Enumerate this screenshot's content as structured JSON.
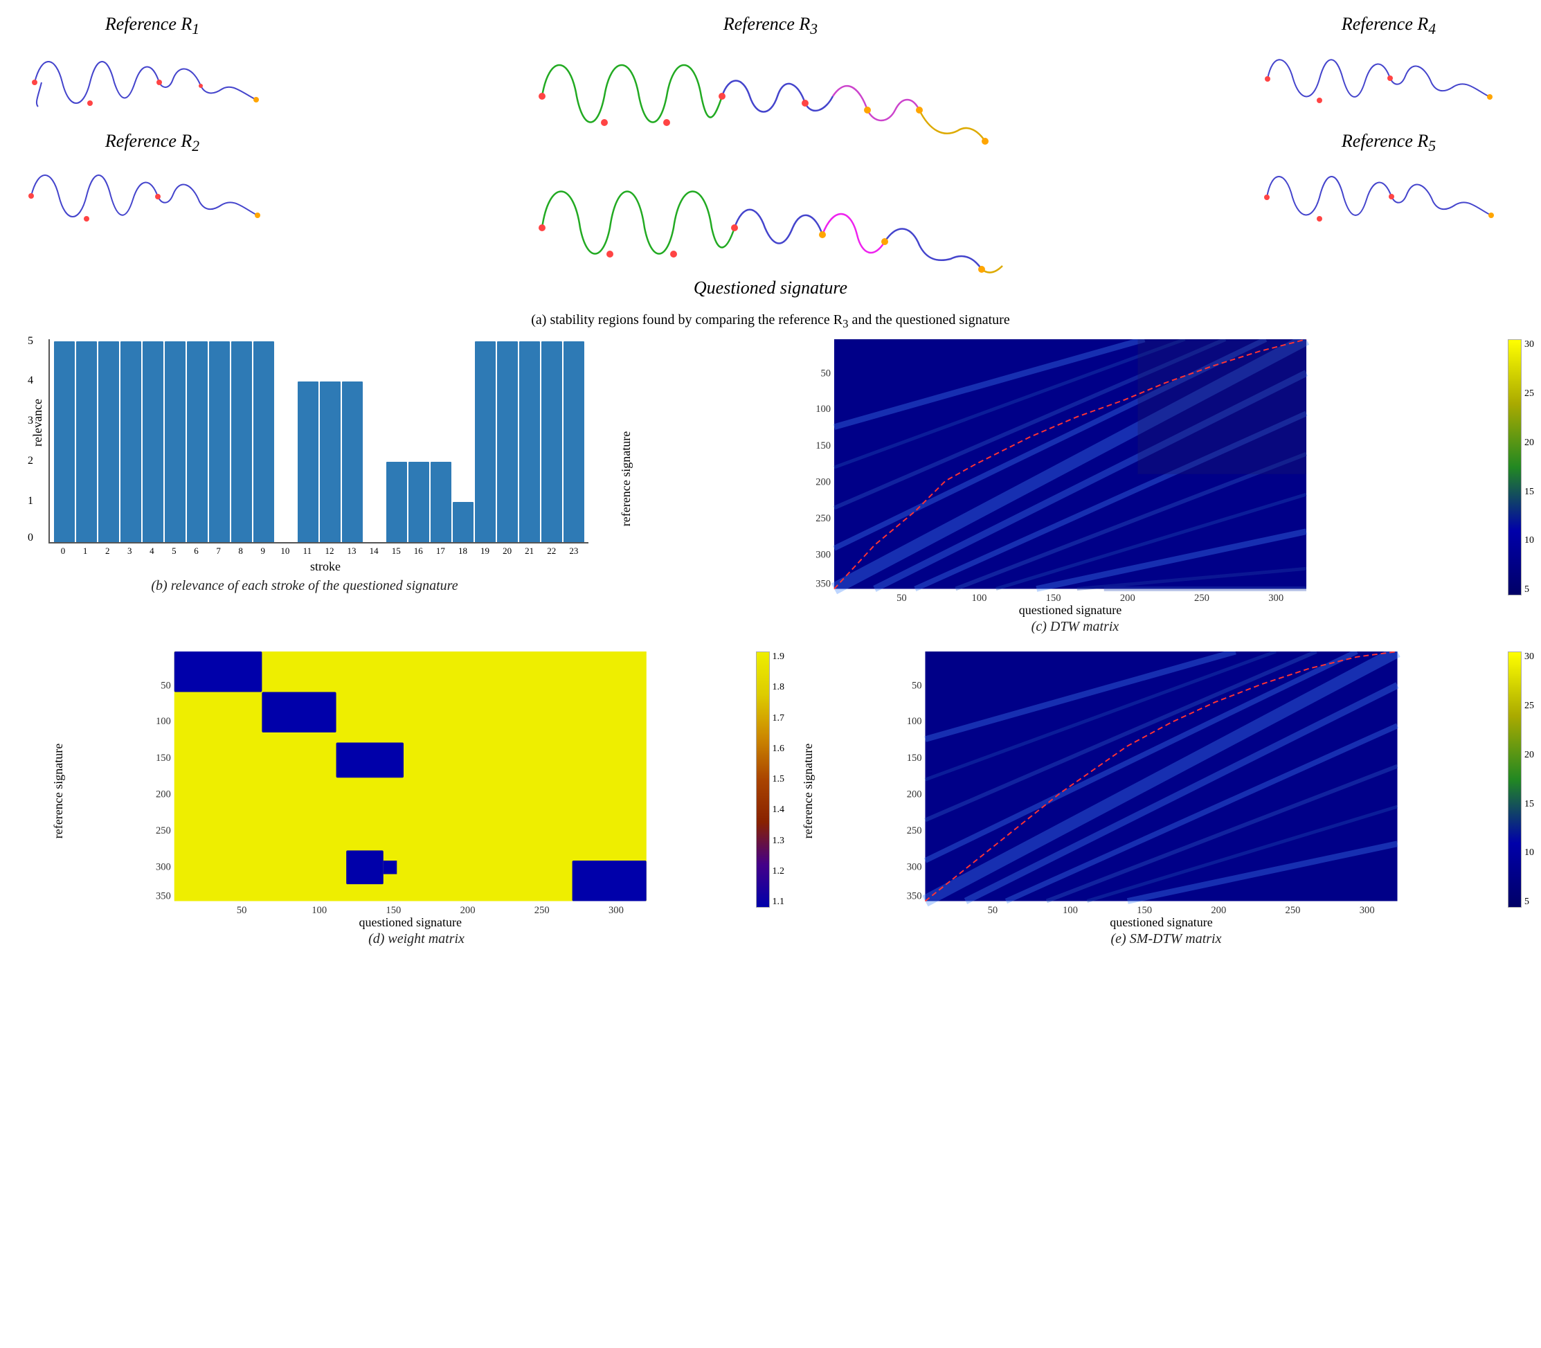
{
  "signatures": {
    "ref1_label": "Reference R",
    "ref1_sub": "1",
    "ref2_label": "Reference R",
    "ref2_sub": "2",
    "ref3_label": "Reference R",
    "ref3_sub": "3",
    "ref4_label": "Reference R",
    "ref4_sub": "4",
    "ref5_label": "Reference R",
    "ref5_sub": "5",
    "questioned_label": "Questioned signature"
  },
  "captions": {
    "a": "(a) stability regions found by comparing the reference R",
    "a_sub": "3",
    "a_rest": " and the questioned signature",
    "b": "(b) relevance of each stroke of the questioned signature",
    "c": "(c) DTW matrix",
    "d": "(d) weight matrix",
    "e": "(e) SM-DTW matrix"
  },
  "bar_chart": {
    "y_labels": [
      "5",
      "4",
      "3",
      "2",
      "1",
      "0"
    ],
    "y_axis_label": "relevance",
    "x_axis_label": "stroke",
    "bars": [
      {
        "label": "0",
        "value": 5
      },
      {
        "label": "1",
        "value": 5
      },
      {
        "label": "2",
        "value": 5
      },
      {
        "label": "3",
        "value": 5
      },
      {
        "label": "4",
        "value": 5
      },
      {
        "label": "5",
        "value": 5
      },
      {
        "label": "6",
        "value": 5
      },
      {
        "label": "7",
        "value": 5
      },
      {
        "label": "8",
        "value": 5
      },
      {
        "label": "9",
        "value": 5
      },
      {
        "label": "10",
        "value": 0
      },
      {
        "label": "11",
        "value": 4
      },
      {
        "label": "12",
        "value": 4
      },
      {
        "label": "13",
        "value": 4
      },
      {
        "label": "14",
        "value": 0
      },
      {
        "label": "15",
        "value": 2
      },
      {
        "label": "16",
        "value": 2
      },
      {
        "label": "17",
        "value": 2
      },
      {
        "label": "18",
        "value": 1
      },
      {
        "label": "19",
        "value": 5
      },
      {
        "label": "20",
        "value": 5
      },
      {
        "label": "21",
        "value": 5
      },
      {
        "label": "22",
        "value": 5
      },
      {
        "label": "23",
        "value": 5
      }
    ]
  },
  "dtw_colorbar": {
    "values": [
      "30",
      "25",
      "20",
      "15",
      "10",
      "5"
    ]
  },
  "weight_colorbar": {
    "values": [
      "1.9",
      "1.8",
      "1.7",
      "1.6",
      "1.5",
      "1.4",
      "1.3",
      "1.2",
      "1.1"
    ]
  },
  "smdtw_colorbar": {
    "values": [
      "30",
      "25",
      "20",
      "15",
      "10",
      "5"
    ]
  },
  "axes": {
    "q_sig": "questioned signature",
    "r_sig": "reference signature",
    "x_ticks": [
      "50",
      "100",
      "150",
      "200",
      "250",
      "300"
    ],
    "y_ticks": [
      "50",
      "100",
      "150",
      "200",
      "250",
      "300",
      "350"
    ]
  }
}
